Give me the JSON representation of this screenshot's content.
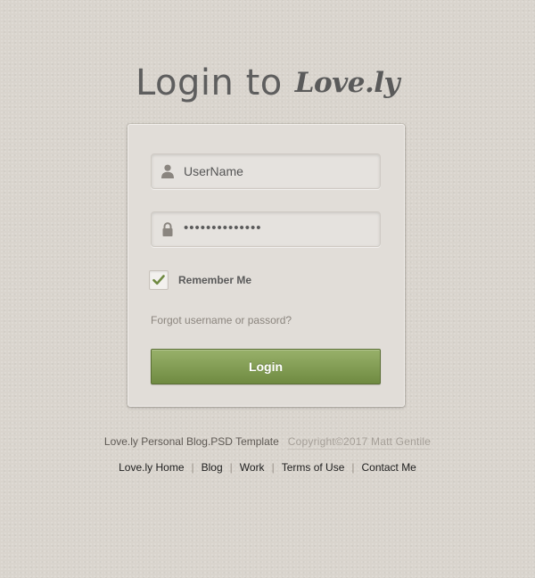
{
  "header": {
    "title_prefix": "Login to",
    "brand": "Love.ly"
  },
  "form": {
    "username": {
      "value": "UserName",
      "icon": "user-icon"
    },
    "password": {
      "value": "••••••••••••••",
      "icon": "lock-icon"
    },
    "remember": {
      "label": "Remember Me",
      "checked": true,
      "check_color": "#6f8a41"
    },
    "forgot_link": "Forgot username or passord?",
    "login_button": "Login",
    "button_color": "#7f9a4e"
  },
  "footer": {
    "template_text": "Love.ly Personal Blog.PSD Template",
    "copyright": "Copyright©2017 Matt Gentile",
    "nav": [
      {
        "label": "Love.ly Home"
      },
      {
        "label": "Blog"
      },
      {
        "label": "Work"
      },
      {
        "label": "Terms of Use"
      },
      {
        "label": "Contact Me"
      }
    ],
    "separator": "|"
  }
}
